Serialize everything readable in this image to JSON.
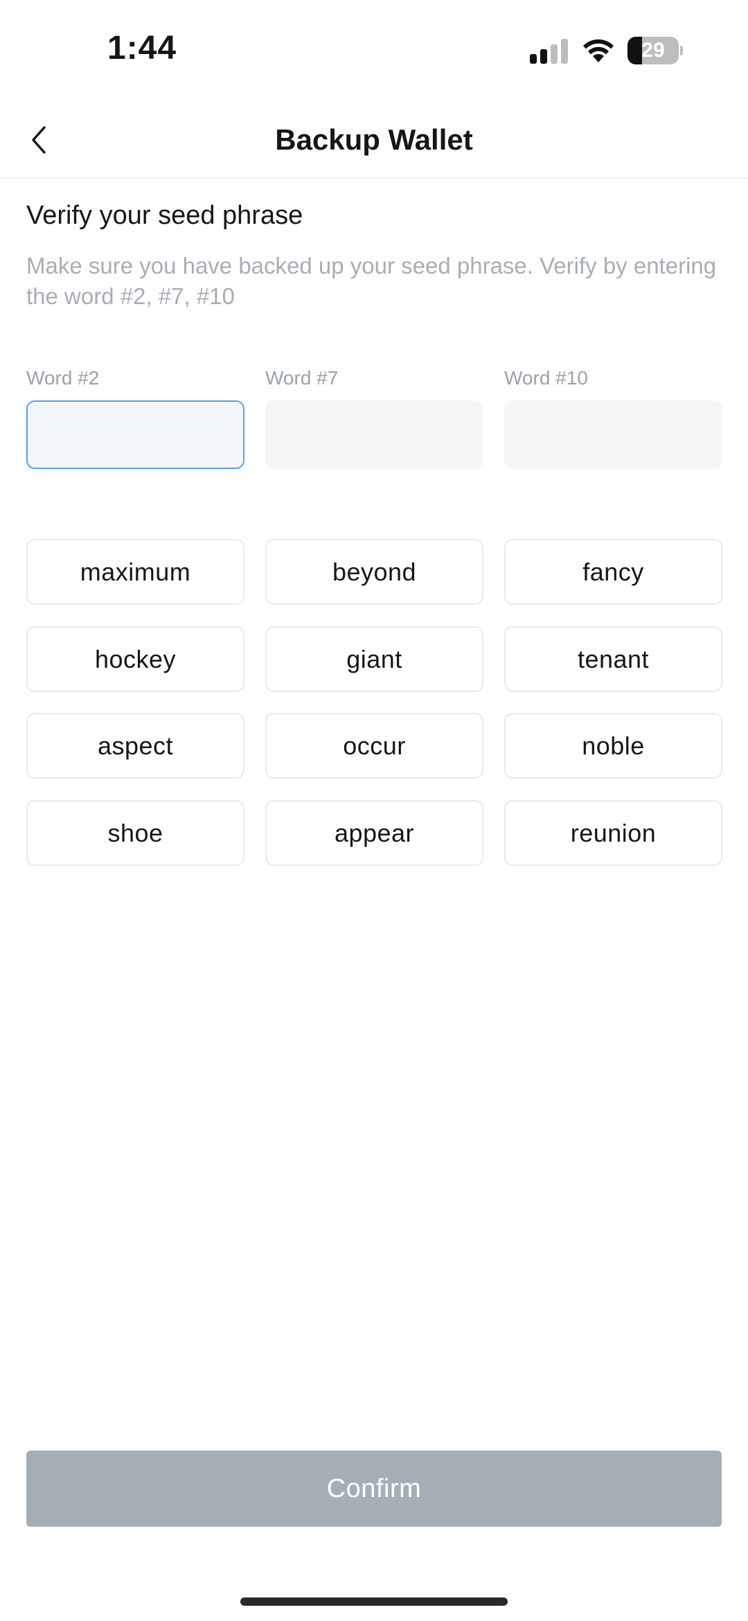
{
  "status_bar": {
    "time": "1:44",
    "battery_level": "29",
    "battery_fraction": 0.29,
    "icons": [
      "signal-icon",
      "wifi-icon",
      "battery-icon"
    ]
  },
  "header": {
    "title": "Backup Wallet",
    "back_icon": "chevron-left-icon"
  },
  "content": {
    "section_title": "Verify your seed phrase",
    "description": "Make sure you have backed up your seed phrase. Verify by entering the word #2, #7, #10",
    "inputs": [
      {
        "label": "Word #2",
        "value": "",
        "active": true
      },
      {
        "label": "Word #7",
        "value": "",
        "active": false
      },
      {
        "label": "Word #10",
        "value": "",
        "active": false
      }
    ],
    "word_options": [
      "maximum",
      "beyond",
      "fancy",
      "hockey",
      "giant",
      "tenant",
      "aspect",
      "occur",
      "noble",
      "shoe",
      "appear",
      "reunion"
    ]
  },
  "footer": {
    "confirm_label": "Confirm"
  },
  "colors": {
    "active_border": "#5c9ee6",
    "disabled_button": "#a5aeb7",
    "muted_text": "#a8adb5"
  }
}
